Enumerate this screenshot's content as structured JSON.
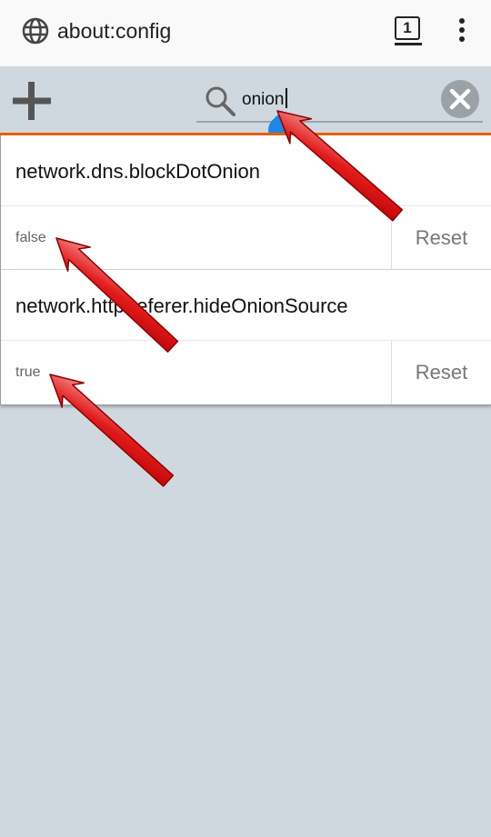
{
  "browser": {
    "url": "about:config",
    "tab_count": "1"
  },
  "toolbar": {
    "search_value": "onion"
  },
  "prefs": [
    {
      "name": "network.dns.blockDotOnion",
      "value": "false",
      "reset_label": "Reset"
    },
    {
      "name": "network.http.referer.hideOnionSource",
      "value": "true",
      "reset_label": "Reset"
    }
  ],
  "colors": {
    "accent_orange": "#e66000",
    "background": "#cfd8df",
    "arrow_red": "#e21b1b",
    "handle_blue": "#1e88e5"
  }
}
